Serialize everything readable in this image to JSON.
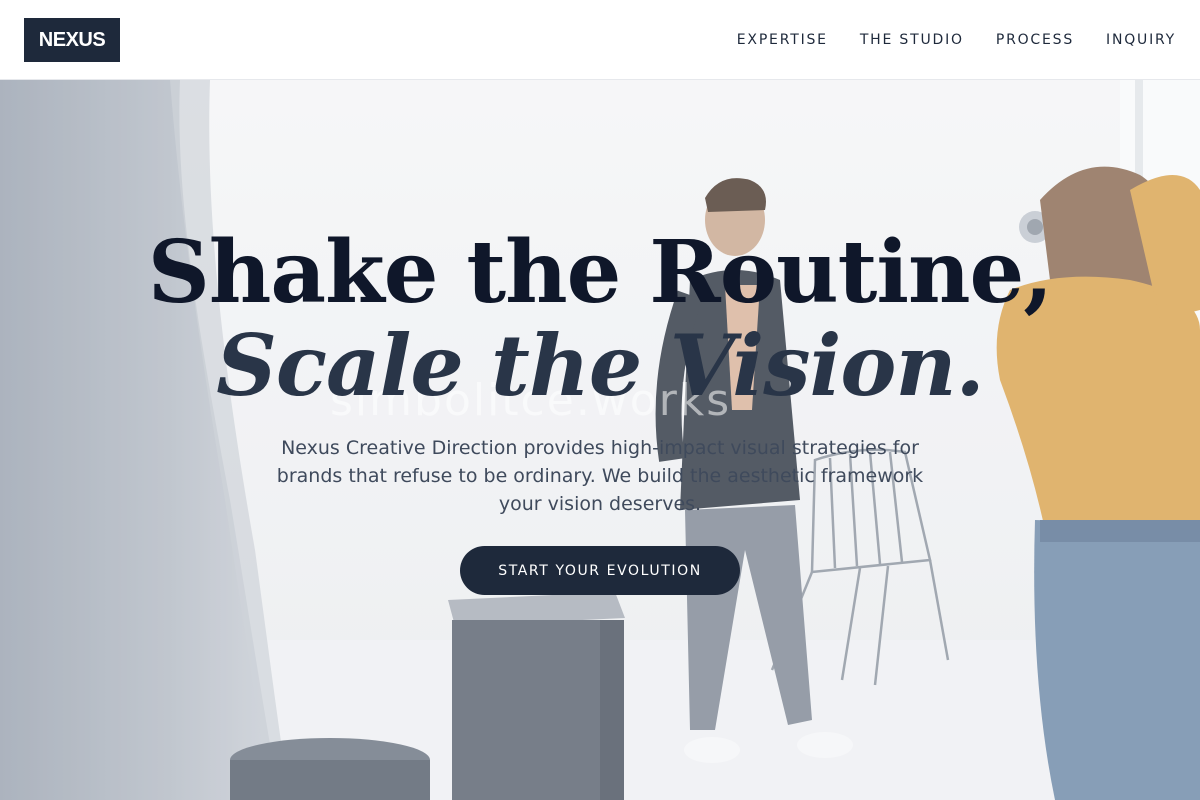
{
  "header": {
    "logo_text": "NEXUS",
    "nav": [
      {
        "label": "EXPERTISE"
      },
      {
        "label": "THE STUDIO"
      },
      {
        "label": "PROCESS"
      },
      {
        "label": "INQUIRY"
      }
    ]
  },
  "hero": {
    "headline_line1": "Shake the Routine,",
    "headline_line2": "Scale the Vision.",
    "subheadline": "Nexus Creative Direction provides high-impact visual strategies for brands that refuse to be ordinary. We build the aesthetic framework your vision deserves.",
    "cta_label": "START YOUR EVOLUTION",
    "background_watermark": "simbolitce.works"
  },
  "colors": {
    "brand_navy": "#1e293b",
    "headline": "#0f172a",
    "headline_italic": "#293548",
    "body_text": "#3f4a5c",
    "hero_background": "#f2f3f5"
  }
}
